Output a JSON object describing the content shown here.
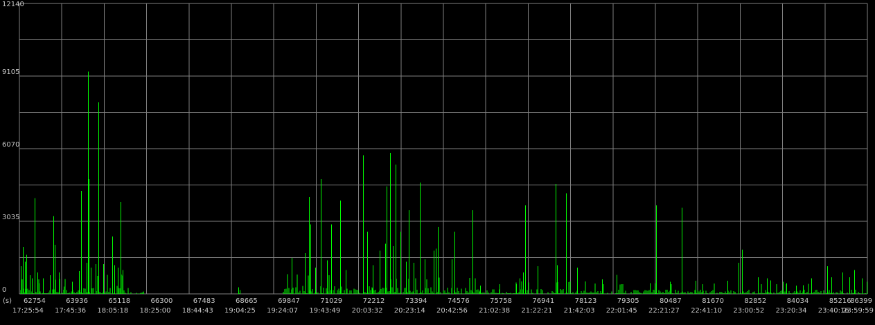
{
  "colors": {
    "background": "#000000",
    "grid": "#808080",
    "series": "#00ff00",
    "text": "#c8c8c8"
  },
  "axis_unit": "(s)",
  "chart_data": {
    "type": "bar",
    "ylim": [
      0,
      12140
    ],
    "y_ticks": [
      "12140",
      "9105",
      "6070",
      "3035",
      "0"
    ],
    "x_ticks": [
      {
        "sec": "62754",
        "time": "17:25:54"
      },
      {
        "sec": "63936",
        "time": "17:45:36"
      },
      {
        "sec": "65118",
        "time": "18:05:18"
      },
      {
        "sec": "66300",
        "time": "18:25:00"
      },
      {
        "sec": "67483",
        "time": "18:44:43"
      },
      {
        "sec": "68665",
        "time": "19:04:25"
      },
      {
        "sec": "69847",
        "time": "19:24:07"
      },
      {
        "sec": "71029",
        "time": "19:43:49"
      },
      {
        "sec": "72212",
        "time": "20:03:32"
      },
      {
        "sec": "73394",
        "time": "20:23:14"
      },
      {
        "sec": "74576",
        "time": "20:42:56"
      },
      {
        "sec": "75758",
        "time": "21:02:38"
      },
      {
        "sec": "76941",
        "time": "21:22:21"
      },
      {
        "sec": "78123",
        "time": "21:42:03"
      },
      {
        "sec": "79305",
        "time": "22:01:45"
      },
      {
        "sec": "80487",
        "time": "22:21:27"
      },
      {
        "sec": "81670",
        "time": "22:41:10"
      },
      {
        "sec": "82852",
        "time": "23:00:52"
      },
      {
        "sec": "84034",
        "time": "23:20:34"
      },
      {
        "sec": "85216",
        "time": "23:40:16"
      },
      {
        "sec": "86399",
        "time": "23:59:59"
      }
    ],
    "xlim": [
      62754,
      86399
    ],
    "grid": true,
    "series": [
      {
        "peaks": [
          [
            62800,
            1150
          ],
          [
            62860,
            1970
          ],
          [
            62900,
            1350
          ],
          [
            62940,
            1630
          ],
          [
            63040,
            780
          ],
          [
            63110,
            650
          ],
          [
            63170,
            4000
          ],
          [
            63260,
            900
          ],
          [
            63300,
            450
          ],
          [
            63420,
            650
          ],
          [
            63600,
            780
          ],
          [
            63700,
            3250
          ],
          [
            63730,
            2050
          ],
          [
            63850,
            900
          ],
          [
            63990,
            300
          ],
          [
            64230,
            500
          ],
          [
            64420,
            950
          ],
          [
            64480,
            4300
          ],
          [
            64620,
            1300
          ],
          [
            64660,
            9300
          ],
          [
            64680,
            4800
          ],
          [
            64750,
            1100
          ],
          [
            64870,
            1250
          ],
          [
            64960,
            8000
          ],
          [
            65100,
            1250
          ],
          [
            65350,
            2400
          ],
          [
            65410,
            1200
          ],
          [
            65500,
            1100
          ],
          [
            65580,
            3850
          ],
          [
            65640,
            1000
          ],
          [
            66200,
            70
          ],
          [
            68850,
            280
          ],
          [
            68900,
            160
          ],
          [
            70350,
            1500
          ],
          [
            70720,
            1700
          ],
          [
            70820,
            4050
          ],
          [
            70870,
            2900
          ],
          [
            71000,
            1100
          ],
          [
            71150,
            4800
          ],
          [
            71340,
            1400
          ],
          [
            71450,
            2900
          ],
          [
            71700,
            3900
          ],
          [
            71860,
            1000
          ],
          [
            72340,
            5800
          ],
          [
            72450,
            2600
          ],
          [
            72600,
            1200
          ],
          [
            72800,
            1800
          ],
          [
            72950,
            2100
          ],
          [
            73000,
            4500
          ],
          [
            73080,
            5900
          ],
          [
            73160,
            2000
          ],
          [
            73250,
            5400
          ],
          [
            73380,
            2600
          ],
          [
            73530,
            1350
          ],
          [
            73620,
            3500
          ],
          [
            73750,
            1300
          ],
          [
            73920,
            4650
          ],
          [
            74050,
            1450
          ],
          [
            74310,
            1800
          ],
          [
            74360,
            1900
          ],
          [
            74420,
            2800
          ],
          [
            74800,
            1450
          ],
          [
            74880,
            2600
          ],
          [
            75390,
            3500
          ],
          [
            75600,
            350
          ],
          [
            76150,
            400
          ],
          [
            76600,
            400
          ],
          [
            76700,
            650
          ],
          [
            76800,
            900
          ],
          [
            76860,
            3700
          ],
          [
            77200,
            1150
          ],
          [
            77700,
            4600
          ],
          [
            77750,
            1200
          ],
          [
            78000,
            4200
          ],
          [
            78300,
            1100
          ],
          [
            79000,
            600
          ],
          [
            79400,
            800
          ],
          [
            80340,
            450
          ],
          [
            80470,
            450
          ],
          [
            80500,
            3700
          ],
          [
            80900,
            500
          ],
          [
            81230,
            3600
          ],
          [
            81600,
            550
          ],
          [
            81800,
            400
          ],
          [
            82500,
            550
          ],
          [
            82800,
            1300
          ],
          [
            82910,
            1850
          ],
          [
            83350,
            700
          ],
          [
            83600,
            650
          ],
          [
            83700,
            560
          ],
          [
            84040,
            500
          ],
          [
            84140,
            450
          ],
          [
            84400,
            350
          ],
          [
            84600,
            360
          ],
          [
            84840,
            650
          ],
          [
            85280,
            1150
          ],
          [
            85400,
            700
          ],
          [
            85700,
            900
          ],
          [
            85900,
            700
          ],
          [
            86030,
            1000
          ],
          [
            86250,
            650
          ],
          [
            86380,
            500
          ]
        ],
        "activity": [
          [
            62754,
            64200,
            300
          ],
          [
            64200,
            65700,
            380
          ],
          [
            65700,
            66250,
            110
          ],
          [
            68840,
            68920,
            80
          ],
          [
            70100,
            72600,
            380
          ],
          [
            72600,
            75600,
            310
          ],
          [
            75600,
            78600,
            240
          ],
          [
            78600,
            86399,
            200
          ]
        ]
      }
    ]
  }
}
